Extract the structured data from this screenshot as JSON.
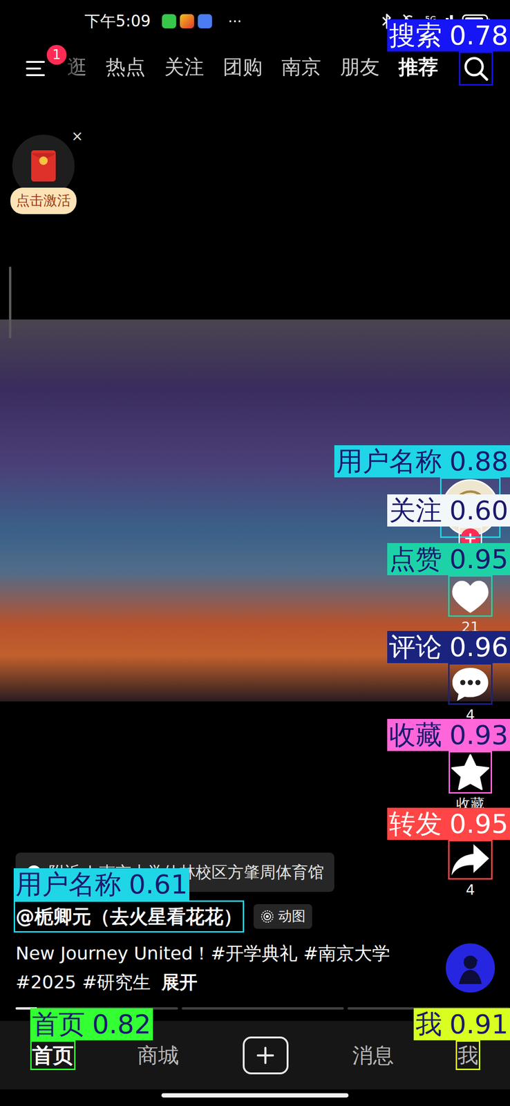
{
  "status_bar": {
    "time": "下午5:09",
    "more": "···",
    "network": "5G"
  },
  "top_nav": {
    "menu_badge": "1",
    "tabs": [
      {
        "label": "逛",
        "selected": false
      },
      {
        "label": "热点",
        "selected": false
      },
      {
        "label": "关注",
        "selected": false
      },
      {
        "label": "团购",
        "selected": false
      },
      {
        "label": "南京",
        "selected": false
      },
      {
        "label": "朋友",
        "selected": false
      },
      {
        "label": "推荐",
        "selected": true
      }
    ],
    "search": {
      "annotation": {
        "label": "搜索",
        "score": "0.78",
        "color": "#1515f5"
      }
    }
  },
  "promo": {
    "close": "×",
    "label": "点击激活"
  },
  "author": {
    "annotation": {
      "label": "用户名称",
      "score": "0.88",
      "color": "#1fd6e6"
    }
  },
  "follow": {
    "symbol": "+",
    "annotation": {
      "label": "关注",
      "score": "0.60",
      "color": "#f2f7fa"
    }
  },
  "actions": [
    {
      "kind": "like",
      "count": "21",
      "annotation": {
        "label": "点赞",
        "score": "0.95",
        "color": "#1ed2a8"
      }
    },
    {
      "kind": "comment",
      "count": "4",
      "annotation": {
        "label": "评论",
        "score": "0.96",
        "color": "#1a237e"
      }
    },
    {
      "kind": "collect",
      "count": "收藏",
      "annotation": {
        "label": "收藏",
        "score": "0.93",
        "color": "#ff66d9"
      }
    },
    {
      "kind": "share",
      "count": "4",
      "annotation": {
        "label": "转发",
        "score": "0.95",
        "color": "#ff4545"
      }
    }
  ],
  "post": {
    "location": {
      "prefix": "附近",
      "separator": "|",
      "place": "南京大学仙林校区方肇周体育馆"
    },
    "username": "@栀卿元（去火星看花花）",
    "username_annotation": {
      "label": "用户名称",
      "score": "0.61",
      "color": "#1fd6e6"
    },
    "tag": "动图",
    "description": "New Journey United！#开学典礼 #南京大学 #2025 #研究生",
    "expand": "展开"
  },
  "progress": [
    {
      "level": 0.13
    },
    {
      "level": 0
    },
    {
      "level": 0
    }
  ],
  "bottom_nav": {
    "items": [
      {
        "kind": "text",
        "label": "首页",
        "selected": true,
        "annotation": {
          "label": "首页",
          "score": "0.82",
          "color": "#33ff33"
        }
      },
      {
        "kind": "text",
        "label": "商城",
        "selected": false
      },
      {
        "kind": "plus",
        "selected": false
      },
      {
        "kind": "text",
        "label": "消息",
        "selected": false
      },
      {
        "kind": "text",
        "label": "我",
        "selected": false,
        "annotation": {
          "label": "我",
          "score": "0.91",
          "color": "#d8ff1f"
        }
      }
    ]
  }
}
